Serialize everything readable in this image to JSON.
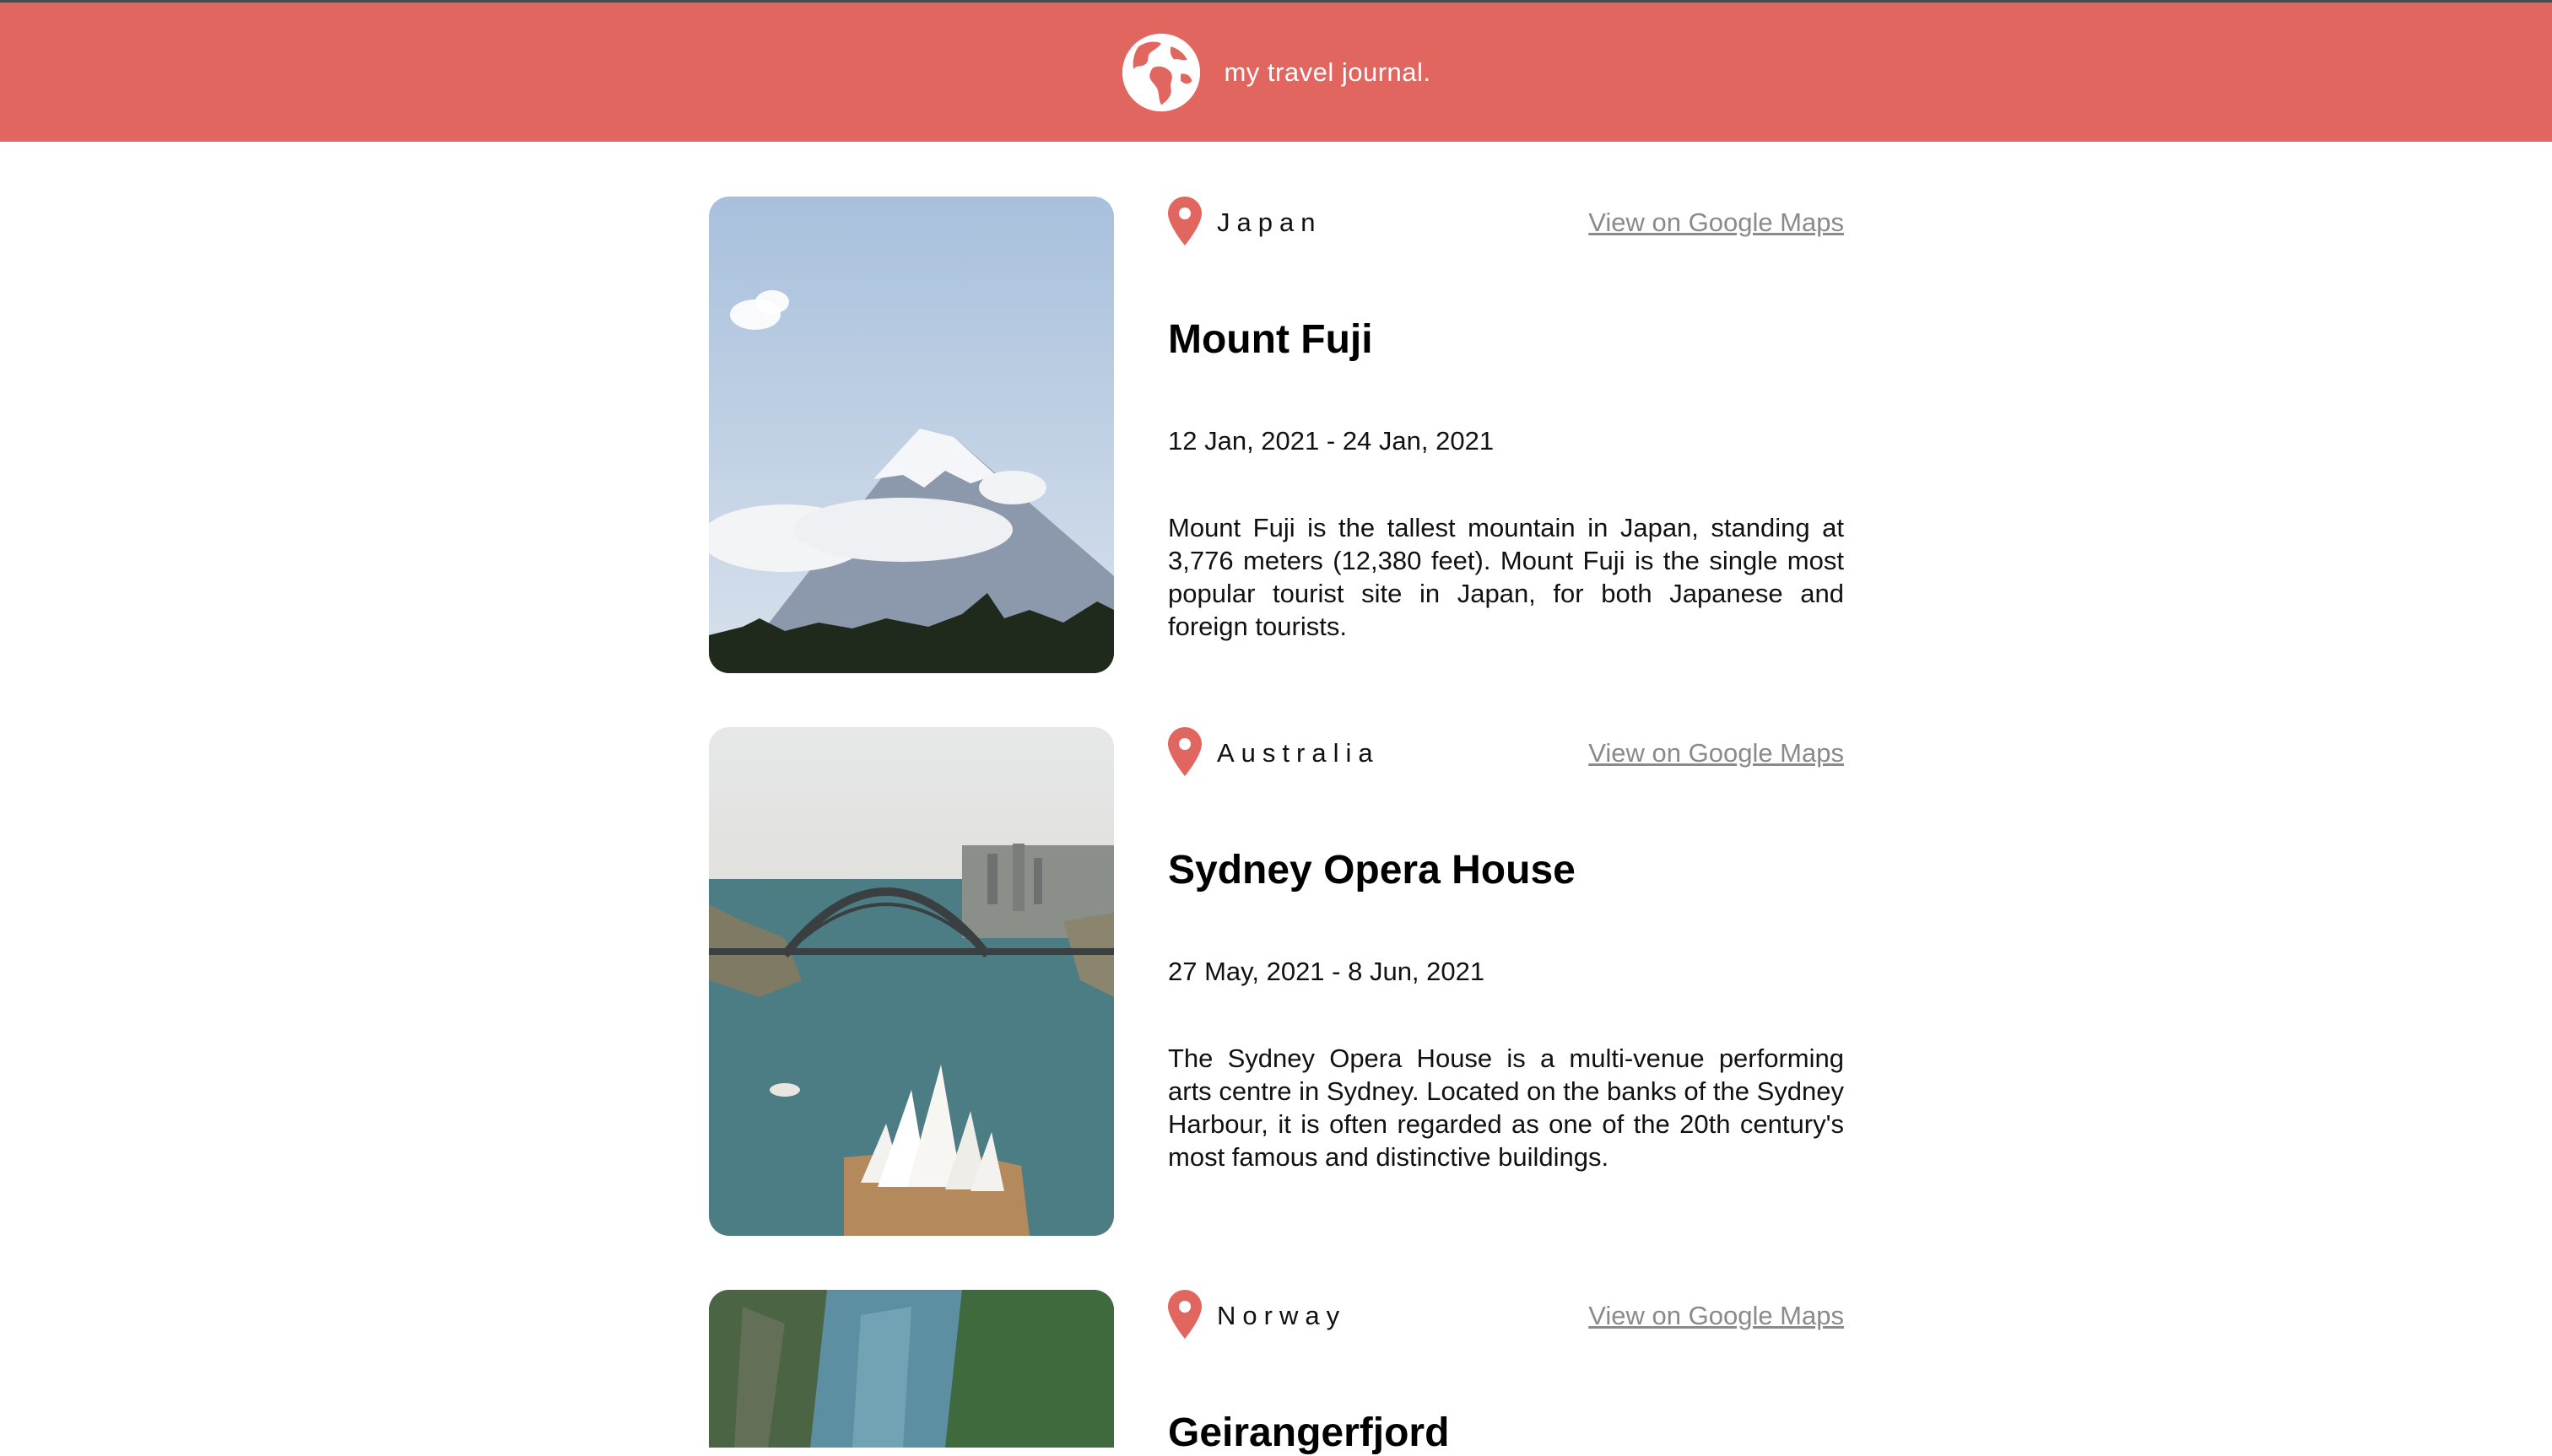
{
  "header": {
    "title": "my travel journal.",
    "icon": "globe-icon",
    "background": "#E26660"
  },
  "entries": [
    {
      "country": "Japan",
      "maps_link": "View on Google Maps",
      "title": "Mount Fuji",
      "dates": "12 Jan, 2021 - 24 Jan, 2021",
      "description": "Mount Fuji is the tallest mountain in Japan, standing at 3,776 meters (12,380 feet). Mount Fuji is the single most popular tourist site in Japan, for both Japanese and foreign tourists.",
      "image": "mount-fuji-photo"
    },
    {
      "country": "Australia",
      "maps_link": "View on Google Maps",
      "title": "Sydney Opera House",
      "dates": "27 May, 2021 - 8 Jun, 2021",
      "description": "The Sydney Opera House is a multi-venue performing arts centre in Sydney. Located on the banks of the Sydney Harbour, it is often regarded as one of the 20th century's most famous and distinctive buildings.",
      "image": "sydney-opera-house-photo"
    },
    {
      "country": "Norway",
      "maps_link": "View on Google Maps",
      "title": "Geirangerfjord",
      "image": "geirangerfjord-photo"
    }
  ],
  "colors": {
    "accent": "#E26660",
    "link": "#8a8a8a"
  }
}
